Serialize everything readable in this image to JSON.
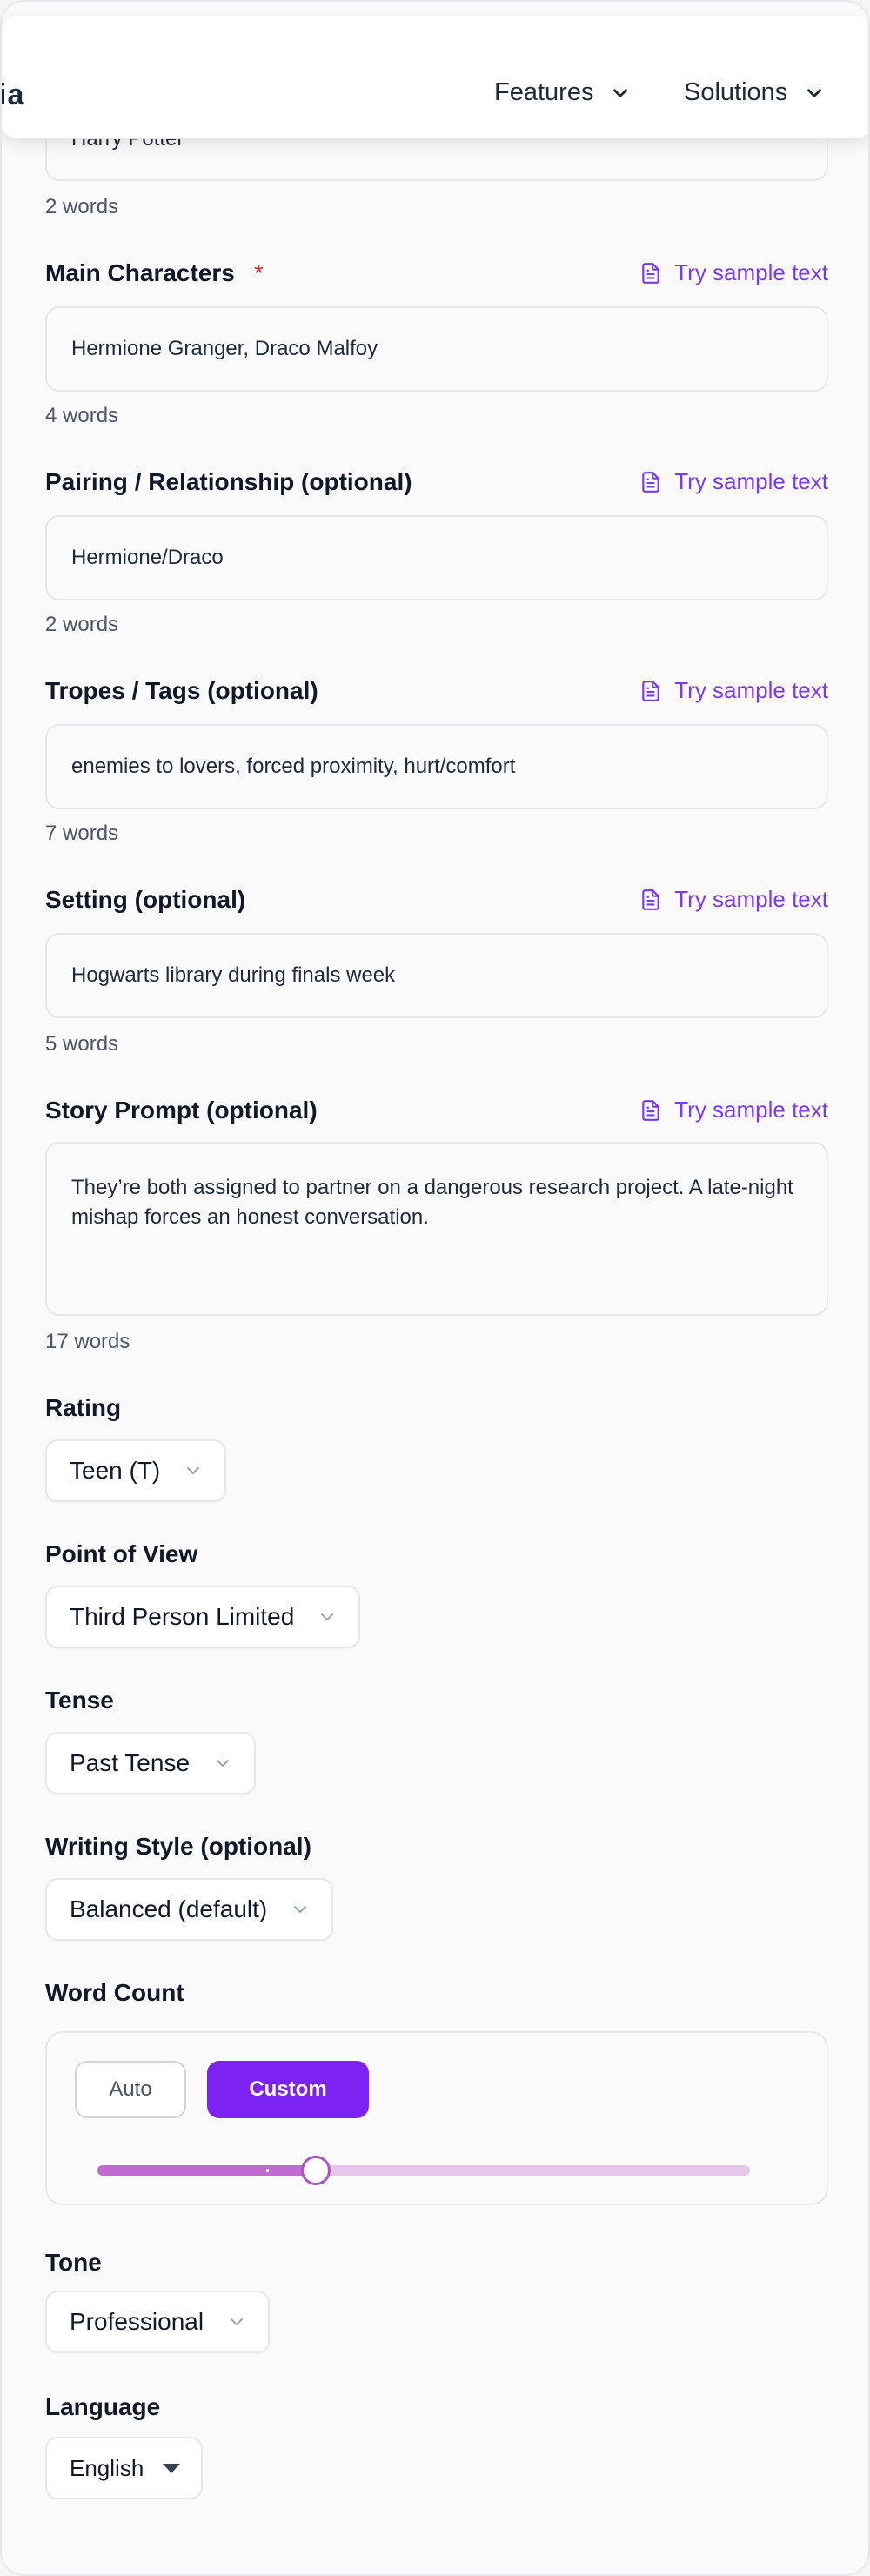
{
  "nav": {
    "logo_fragment": "ia",
    "items": [
      {
        "label": "Features"
      },
      {
        "label": "Solutions"
      }
    ]
  },
  "sample_link_label": "Try sample text",
  "fandom": {
    "value": "Harry Potter",
    "count": "2 words"
  },
  "main_characters": {
    "label": "Main Characters",
    "required": "*",
    "value": "Hermione Granger, Draco Malfoy",
    "count": "4 words"
  },
  "pairing": {
    "label": "Pairing / Relationship (optional)",
    "value": "Hermione/Draco",
    "count": "2 words"
  },
  "tropes": {
    "label": "Tropes / Tags (optional)",
    "value": "enemies to lovers, forced proximity, hurt/comfort",
    "count": "7 words"
  },
  "setting": {
    "label": "Setting (optional)",
    "value": "Hogwarts library during finals week",
    "count": "5 words"
  },
  "story_prompt": {
    "label": "Story Prompt (optional)",
    "value": "They’re both assigned to partner on a dangerous research project. A late-night mishap forces an honest conversation.",
    "count": "17 words"
  },
  "rating": {
    "label": "Rating",
    "value": "Teen (T)"
  },
  "pov": {
    "label": "Point of View",
    "value": "Third Person Limited"
  },
  "tense": {
    "label": "Tense",
    "value": "Past Tense"
  },
  "writing_style": {
    "label": "Writing Style (optional)",
    "value": "Balanced (default)"
  },
  "word_count": {
    "label": "Word Count",
    "auto_label": "Auto",
    "custom_label": "Custom",
    "selected": "Custom",
    "slider_fraction": 0.335
  },
  "tone": {
    "label": "Tone",
    "value": "Professional"
  },
  "language": {
    "label": "Language",
    "value": "English"
  },
  "colors": {
    "accent": "#7c22f2",
    "link": "#7c3aed",
    "required": "#dc2626",
    "slider_fill": "#c06ad1",
    "slider_track": "#e6c6ea"
  },
  "icons": {
    "sample": "document-icon",
    "dropdown": "chevron-down-icon"
  }
}
